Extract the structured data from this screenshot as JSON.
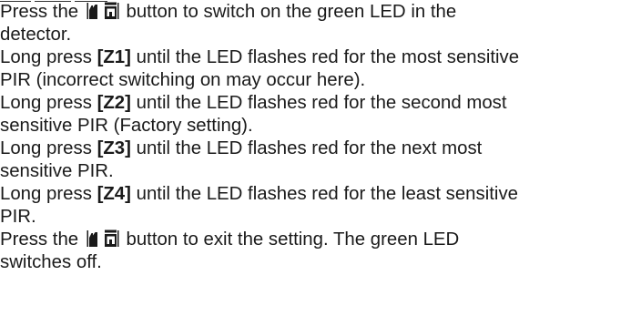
{
  "lines": [
    {
      "kind": "icon",
      "before": "Press the ",
      "after": " button to switch on the green LED in the"
    },
    {
      "kind": "text",
      "text": "detector."
    },
    {
      "kind": "key",
      "before": "Long press ",
      "key": "[Z1]",
      "after": " until the LED flashes red for the most sensitive"
    },
    {
      "kind": "text",
      "text": "PIR (incorrect switching on may occur here)."
    },
    {
      "kind": "key",
      "before": "Long press ",
      "key": "[Z2]",
      "after": " until the LED flashes red for the second most"
    },
    {
      "kind": "text",
      "text": "sensitive PIR (Factory setting)."
    },
    {
      "kind": "key",
      "before": "Long press ",
      "key": "[Z3]",
      "after": " until the LED flashes red for the next most"
    },
    {
      "kind": "text",
      "text": "sensitive PIR."
    },
    {
      "kind": "key",
      "before": "Long press ",
      "key": "[Z4]",
      "after": " until the LED flashes red for the least sensitive"
    },
    {
      "kind": "text",
      "text": "PIR."
    },
    {
      "kind": "icon",
      "before": "Press the ",
      "after": " button to exit the setting. The green LED"
    },
    {
      "kind": "text",
      "text": "switches off."
    }
  ],
  "icons": {
    "button_icon": "brightness-adjust-button-icon"
  },
  "colors": {
    "text": "#1a1a1a",
    "icon_fill": "#1a1a1a"
  }
}
